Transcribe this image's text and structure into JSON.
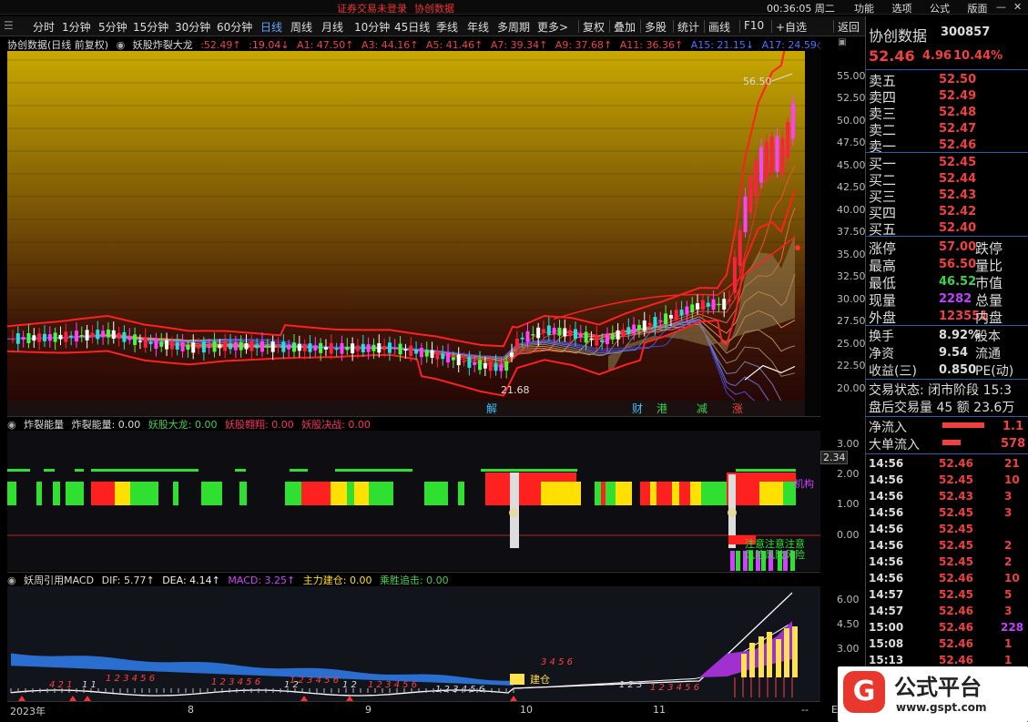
{
  "topbar": {
    "notice_1": "证券交易未登录",
    "notice_2": "协创数据",
    "clock": "00:36:05 周二",
    "menu_1": "功能",
    "menu_2": "选项",
    "menu_3": "公式",
    "menu_4": "版面"
  },
  "periods": [
    "分时",
    "1分钟",
    "5分钟",
    "15分钟",
    "30分钟",
    "60分钟",
    "日线",
    "周线",
    "月线",
    "10分钟",
    "45日线",
    "季线",
    "年线",
    "多周期",
    "更多>"
  ],
  "tools": [
    "复权",
    "叠加",
    "多股",
    "统计",
    "画线",
    "F10",
    "+自选",
    "返回"
  ],
  "panel1": {
    "title": "协创数据(日线 前复权)",
    "indicator": "妖股炸裂大龙",
    "v1": ":52.49↑",
    "v2": ":19.04↓",
    "a1": "A1: 47.50↑",
    "a3": "A3: 44.16↑",
    "a5": "A5: 41.46↑",
    "a7": "A7: 39.34↑",
    "a9": "A9: 37.68↑",
    "a11": "A11: 36.36↑",
    "a15": "A15: 21.15↓",
    "a17": "A17: 24.59◇",
    "high_label": "56.50",
    "low_label": "21.68",
    "y_ticks": [
      "55.00",
      "52.50",
      "50.00",
      "47.50",
      "45.00",
      "42.50",
      "40.00",
      "37.50",
      "35.00",
      "32.50",
      "30.00",
      "27.50",
      "25.00",
      "22.50",
      "20.00"
    ],
    "events": [
      "解",
      "财",
      "港",
      "减",
      "涨"
    ]
  },
  "panel2": {
    "title": "炸裂能量",
    "l1": "炸裂能量: 0.00",
    "l2": "妖股大龙: 0.00",
    "l3": "妖股翱翔: 0.00",
    "l4": "妖股决战: 0.00",
    "y_ticks": [
      "3.00",
      "2.00",
      "1.00",
      "0.00"
    ],
    "marker": "2.34",
    "tag_jigou": "机构",
    "tag_notice_1": "注意",
    "tag_notice_2": "注意",
    "tag_notice_3": "注意",
    "tag_risk_1": "风险",
    "tag_risk_2": "风险",
    "tag_risk_3": "风险"
  },
  "panel3": {
    "title": "妖周引用MACD",
    "dif": "DIF: 5.77↑",
    "dea": "DEA: 4.14↑",
    "macd": "MACD: 3.25↑",
    "zl": "主力建仓: 0.00",
    "cs": "乘胜追击: 0.00",
    "y_ticks": [
      "6.00",
      "4.50",
      "3.00",
      "1.50"
    ],
    "tag": "建仓",
    "digits": [
      "4 2 1",
      "1 1",
      "1 2 3 4 5 6",
      "1 2 3 4 5 6",
      "1 2",
      "1 2 3 4 5 6",
      "1 2",
      "1 2 3 4 5 6",
      "1 2 3 4 5 6",
      "3 4 5 6",
      "1 2 3",
      "1 2 3 4 5 6"
    ]
  },
  "xaxis": [
    "2023年",
    "8",
    "9",
    "10",
    "11"
  ],
  "xaxis_end": "E",
  "quote": {
    "name": "协创数据",
    "code": "300857",
    "price": "52.46",
    "change": "4.96",
    "pct": "10.44%",
    "asks": [
      {
        "l": "卖五",
        "p": "52.50"
      },
      {
        "l": "卖四",
        "p": "52.49"
      },
      {
        "l": "卖三",
        "p": "52.48"
      },
      {
        "l": "卖二",
        "p": "52.47"
      },
      {
        "l": "卖一",
        "p": "52.46"
      }
    ],
    "bids": [
      {
        "l": "买一",
        "p": "52.45"
      },
      {
        "l": "买二",
        "p": "52.44"
      },
      {
        "l": "买三",
        "p": "52.43"
      },
      {
        "l": "买四",
        "p": "52.42"
      },
      {
        "l": "买五",
        "p": "52.40"
      }
    ],
    "stats": [
      {
        "l": "涨停",
        "v": "57.00",
        "r": "跌停",
        "c": "#f04040"
      },
      {
        "l": "最高",
        "v": "56.50",
        "r": "量比",
        "c": "#f04040"
      },
      {
        "l": "最低",
        "v": "46.52",
        "r": "市值",
        "c": "#3fd04f"
      },
      {
        "l": "现量",
        "v": "2282",
        "r": "总量",
        "c": "#c040ff"
      },
      {
        "l": "外盘",
        "v": "123551",
        "r": "内盘",
        "c": "#f04040"
      }
    ],
    "stats2": [
      {
        "l": "换手",
        "v": "8.92%",
        "r": "股本"
      },
      {
        "l": "净资",
        "v": "9.54",
        "r": "流通"
      },
      {
        "l": "收益(三)",
        "v": "0.850",
        "r": "PE(动)"
      }
    ],
    "status": "交易状态: 闭市阶段 15:3",
    "after": "盘后交易量 45 额 23.6万",
    "flow1": {
      "l": "净流入",
      "v": "1.1"
    },
    "flow2": {
      "l": "大单流入",
      "v": "578"
    }
  },
  "ticks": [
    {
      "t": "14:56",
      "p": "52.46",
      "v": "21"
    },
    {
      "t": "14:56",
      "p": "52.45",
      "v": "10"
    },
    {
      "t": "14:56",
      "p": "52.43",
      "v": "3"
    },
    {
      "t": "14:56",
      "p": "52.45",
      "v": "3"
    },
    {
      "t": "14:56",
      "p": "52.45",
      "v": ""
    },
    {
      "t": "14:56",
      "p": "52.45",
      "v": "2"
    },
    {
      "t": "14:56",
      "p": "52.45",
      "v": "2"
    },
    {
      "t": "14:56",
      "p": "52.46",
      "v": "10"
    },
    {
      "t": "14:57",
      "p": "52.45",
      "v": "5"
    },
    {
      "t": "14:57",
      "p": "52.46",
      "v": "3"
    },
    {
      "t": "15:00",
      "p": "52.46",
      "v": "228"
    },
    {
      "t": "15:08",
      "p": "52.46",
      "v": "1"
    },
    {
      "t": "15:13",
      "p": "52.46",
      "v": "1"
    }
  ],
  "logo": {
    "glyph": "G",
    "title": "公式平台",
    "url": "www.gspt.com"
  }
}
